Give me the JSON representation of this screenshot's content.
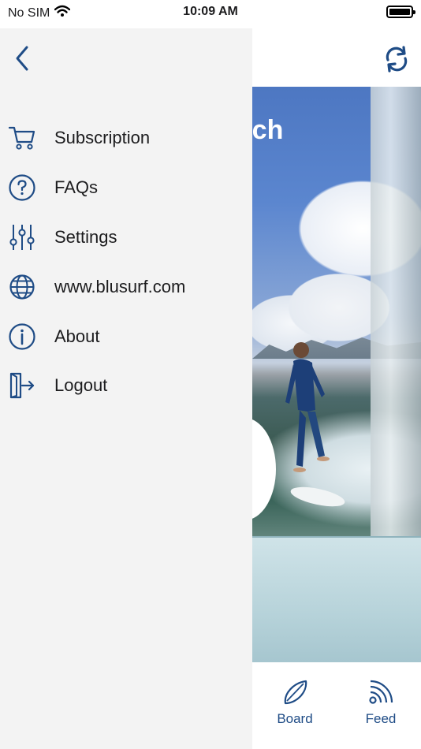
{
  "status": {
    "carrier": "No SIM",
    "time": "10:09 AM"
  },
  "hero": {
    "title_fragment": "bach"
  },
  "drawer": {
    "items": [
      {
        "label": "Subscription",
        "icon": "cart-icon"
      },
      {
        "label": "FAQs",
        "icon": "question-circle-icon"
      },
      {
        "label": "Settings",
        "icon": "sliders-icon"
      },
      {
        "label": "www.blusurf.com",
        "icon": "globe-icon"
      },
      {
        "label": "About",
        "icon": "info-circle-icon"
      },
      {
        "label": "Logout",
        "icon": "logout-icon"
      }
    ]
  },
  "tabs": [
    {
      "label": "Board",
      "icon": "surfboard-icon"
    },
    {
      "label": "Feed",
      "icon": "rss-feed-icon"
    }
  ],
  "colors": {
    "accent": "#1f4c86",
    "drawer_bg": "#f3f3f3"
  }
}
